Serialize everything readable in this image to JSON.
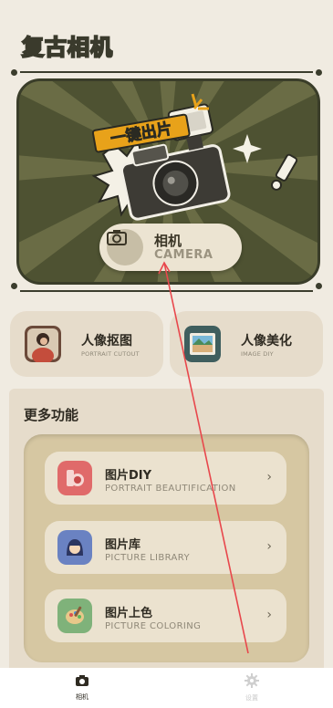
{
  "app": {
    "title": "复古相机"
  },
  "hero": {
    "sticker_text": "一键出片",
    "pill": {
      "title": "相机",
      "subtitle": "CAMERA"
    }
  },
  "features": [
    {
      "title": "人像抠图",
      "subtitle": "PORTRAIT CUTOUT",
      "icon": "portrait-cutout-icon"
    },
    {
      "title": "人像美化",
      "subtitle": "IMAGE DIY",
      "icon": "landscape-photo-icon"
    }
  ],
  "more": {
    "title": "更多功能",
    "items": [
      {
        "title": "图片DIY",
        "subtitle": "PORTRAIT BEAUTIFICATION",
        "icon": "lipstick-icon",
        "color": "#e06a6a"
      },
      {
        "title": "图片库",
        "subtitle": "PICTURE LIBRARY",
        "icon": "girl-avatar-icon",
        "color": "#6a82c2"
      },
      {
        "title": "图片上色",
        "subtitle": "PICTURE COLORING",
        "icon": "palette-icon",
        "color": "#7fb27a"
      }
    ],
    "arrow": "›"
  },
  "tabbar": {
    "tabs": [
      {
        "label": "相机",
        "active": true
      },
      {
        "label": "设置",
        "active": false
      }
    ]
  },
  "colors": {
    "background": "#f0ebe1",
    "hero_dark": "#4e5232",
    "card": "#e6dccb",
    "inner_panel": "#d6c7a2",
    "annotation_line": "#e8474c"
  }
}
